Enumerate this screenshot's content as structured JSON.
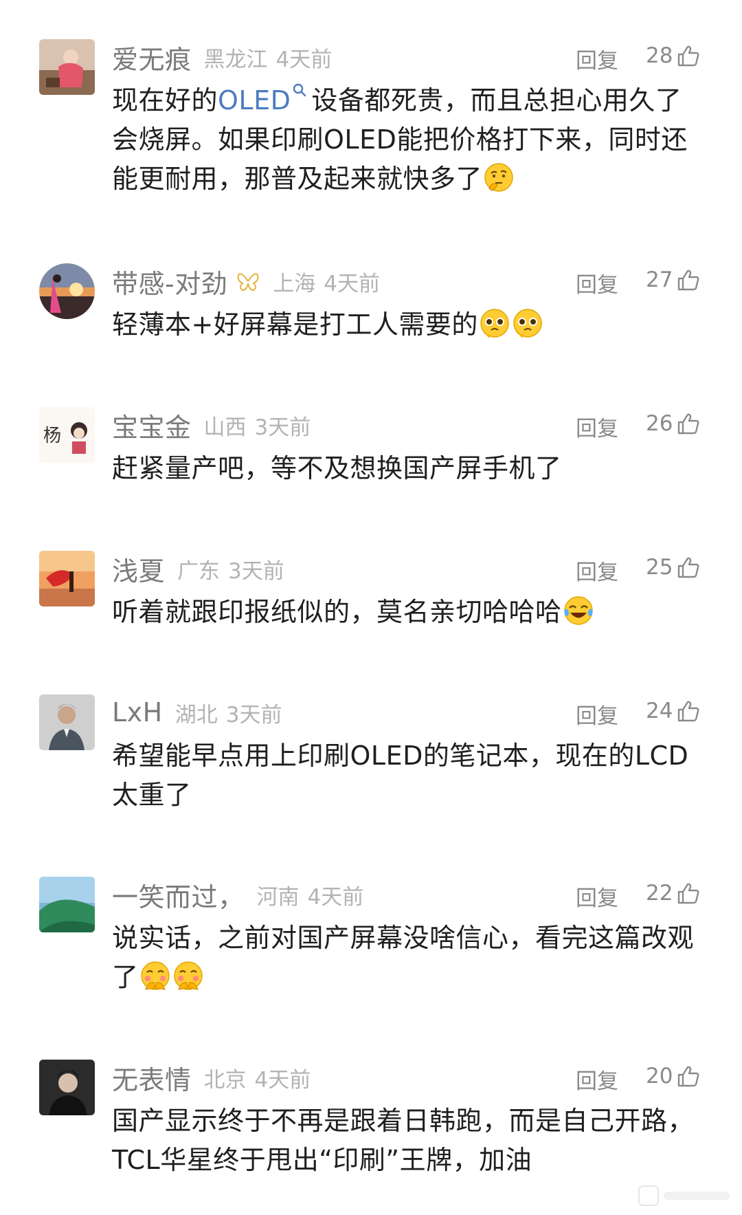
{
  "reply_label": "回复",
  "comments": [
    {
      "username": "爱无痕",
      "location": "黑龙江",
      "time": "4天前",
      "likes": "28",
      "text_before": "现在好的",
      "link_text": "OLED",
      "text_after": "设备都死贵，而且总担心用久了会烧屏。如果印刷OLED能把价格打下来，同时还能更耐用，那普及起来就快多了"
    },
    {
      "username": "带感-对劲",
      "location": "上海",
      "time": "4天前",
      "likes": "27",
      "text": "轻薄本+好屏幕是打工人需要的"
    },
    {
      "username": "宝宝金",
      "location": "山西",
      "time": "3天前",
      "likes": "26",
      "text": "赶紧量产吧，等不及想换国产屏手机了"
    },
    {
      "username": "浅夏",
      "location": "广东",
      "time": "3天前",
      "likes": "25",
      "text": "听着就跟印报纸似的，莫名亲切哈哈哈"
    },
    {
      "username": "LxH",
      "location": "湖北",
      "time": "3天前",
      "likes": "24",
      "text": "希望能早点用上印刷OLED的笔记本，现在的LCD太重了"
    },
    {
      "username": "一笑而过，",
      "location": "河南",
      "time": "4天前",
      "likes": "22",
      "text": "说实话，之前对国产屏幕没啥信心，看完这篇改观了"
    },
    {
      "username": "无表情",
      "location": "北京",
      "time": "4天前",
      "likes": "20",
      "text": "国产显示终于不再是跟着日韩跑，而是自己开路，TCL华星终于甩出“印刷”王牌，加油"
    }
  ],
  "colors": {
    "username": "#7a7a7a",
    "meta": "#b3b3b3",
    "link": "#4d7cbf",
    "text": "#1f1f1f"
  },
  "icons": {
    "like": "thumbs-up-icon",
    "link_search": "search-icon",
    "badge": "butterfly-badge-icon"
  }
}
